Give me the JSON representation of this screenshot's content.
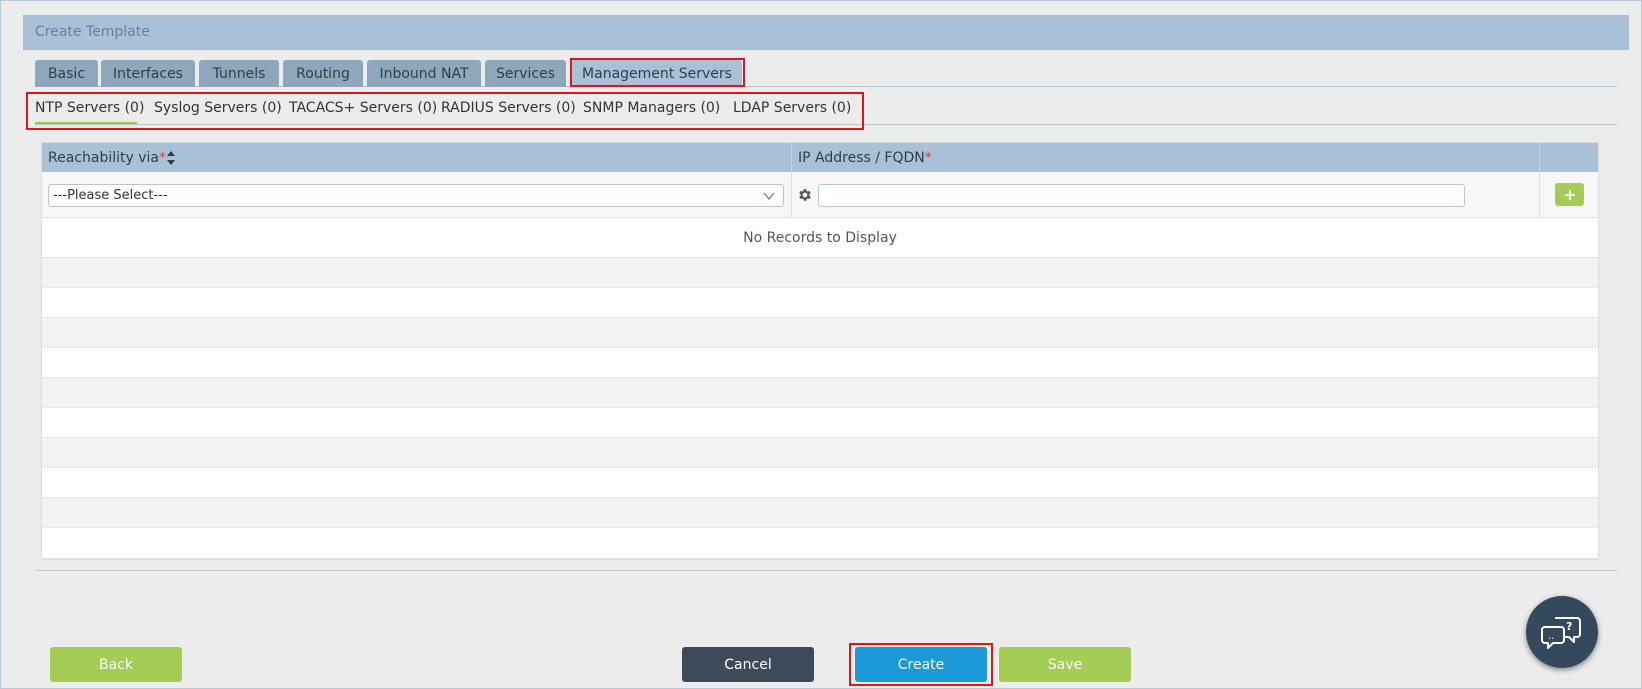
{
  "title": "Create Template",
  "tabs": [
    {
      "label": "Basic"
    },
    {
      "label": "Interfaces"
    },
    {
      "label": "Tunnels"
    },
    {
      "label": "Routing"
    },
    {
      "label": "Inbound NAT"
    },
    {
      "label": "Services"
    },
    {
      "label": "Management Servers"
    }
  ],
  "active_tab": "Management Servers",
  "subtabs": [
    {
      "label": "NTP Servers (0)"
    },
    {
      "label": "Syslog Servers (0)"
    },
    {
      "label": "TACACS+ Servers (0)"
    },
    {
      "label": "RADIUS Servers (0)"
    },
    {
      "label": "SNMP Managers (0)"
    },
    {
      "label": "LDAP Servers (0)"
    }
  ],
  "active_subtab": "NTP Servers (0)",
  "grid": {
    "columns": [
      {
        "label": "Reachability via",
        "required": "*"
      },
      {
        "label": "IP Address / FQDN",
        "required": "*"
      }
    ],
    "reachability_select": {
      "selected": "---Please Select---"
    },
    "ip_input": {
      "value": "",
      "placeholder": ""
    },
    "empty_message": "No Records to Display"
  },
  "buttons": {
    "back": "Back",
    "cancel": "Cancel",
    "create": "Create",
    "save": "Save"
  },
  "icons": {
    "sort": "sort-icon",
    "gear": "gear-icon",
    "add": "plus-icon",
    "chevron": "chevron-down-icon",
    "help": "help-chat-icon"
  },
  "colors": {
    "accent_green": "#a4cd55",
    "primary_blue": "#1b9ad7",
    "dark": "#3d4a59",
    "tab_bg": "#8ea7bd",
    "header_bg": "#a9c1d6",
    "highlight_red": "#e1141b"
  }
}
